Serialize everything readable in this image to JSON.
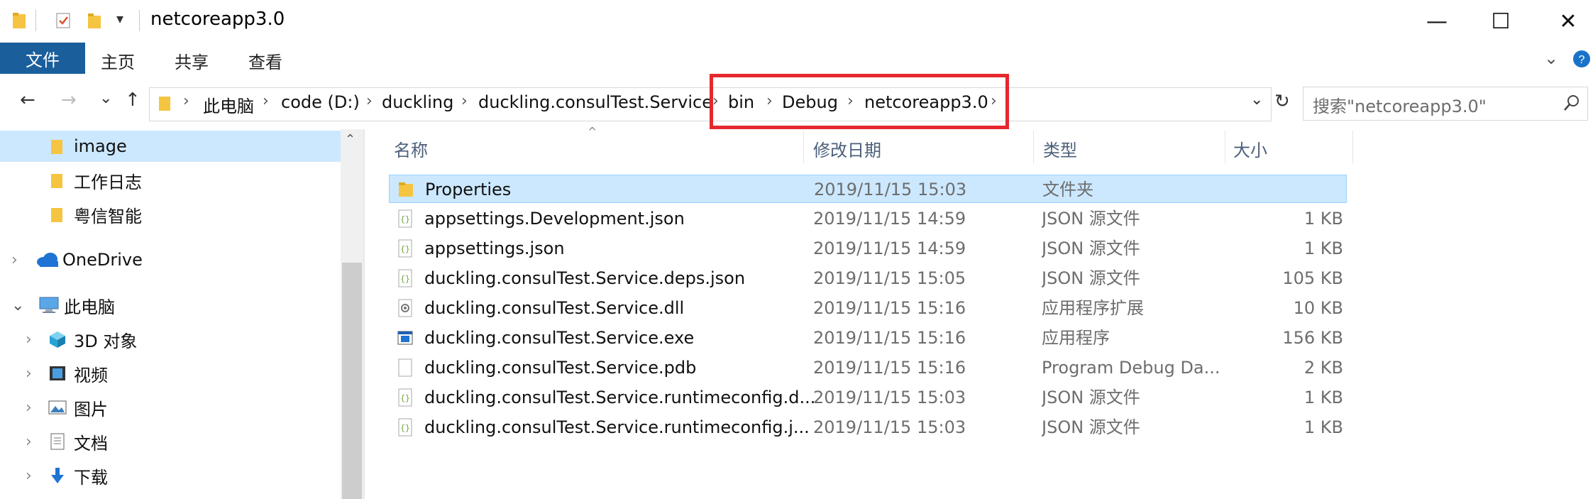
{
  "window": {
    "title": "netcoreapp3.0",
    "minimize_glyph": "—",
    "maximize_glyph": "☐",
    "close_glyph": "✕"
  },
  "ribbon": {
    "tabs": [
      "文件",
      "主页",
      "共享",
      "查看"
    ]
  },
  "nav": {
    "back_glyph": "←",
    "forward_glyph": "→",
    "recent_glyph": "⌄",
    "up_glyph": "↑",
    "refresh_glyph": "↻",
    "dropdown_glyph": "⌄"
  },
  "breadcrumb": [
    "此电脑",
    "code (D:)",
    "duckling",
    "duckling.consulTest.Service",
    "bin",
    "Debug",
    "netcoreapp3.0"
  ],
  "search": {
    "placeholder": "搜索\"netcoreapp3.0\""
  },
  "sidebar": {
    "items": [
      {
        "label": "image",
        "icon": "folder-icon",
        "selected": true
      },
      {
        "label": "工作日志",
        "icon": "folder-icon"
      },
      {
        "label": "粤信智能",
        "icon": "folder-icon"
      },
      {
        "label": "OneDrive",
        "icon": "cloud-icon",
        "expander": "›"
      },
      {
        "label": "此电脑",
        "icon": "computer-icon",
        "expander": "⌄"
      },
      {
        "label": "3D 对象",
        "icon": "cube-icon",
        "expander": "›"
      },
      {
        "label": "视频",
        "icon": "video-icon",
        "expander": "›"
      },
      {
        "label": "图片",
        "icon": "picture-icon",
        "expander": "›"
      },
      {
        "label": "文档",
        "icon": "document-icon",
        "expander": "›"
      },
      {
        "label": "下载",
        "icon": "download-icon",
        "expander": "›"
      }
    ]
  },
  "columns": {
    "name": "名称",
    "date": "修改日期",
    "type": "类型",
    "size": "大小"
  },
  "files": [
    {
      "name": "Properties",
      "date": "2019/11/15 15:03",
      "type": "文件夹",
      "size": "",
      "icon": "folder-icon",
      "selected": true
    },
    {
      "name": "appsettings.Development.json",
      "date": "2019/11/15 14:59",
      "type": "JSON 源文件",
      "size": "1 KB",
      "icon": "json-file-icon"
    },
    {
      "name": "appsettings.json",
      "date": "2019/11/15 14:59",
      "type": "JSON 源文件",
      "size": "1 KB",
      "icon": "json-file-icon"
    },
    {
      "name": "duckling.consulTest.Service.deps.json",
      "date": "2019/11/15 15:05",
      "type": "JSON 源文件",
      "size": "105 KB",
      "icon": "json-file-icon"
    },
    {
      "name": "duckling.consulTest.Service.dll",
      "date": "2019/11/15 15:16",
      "type": "应用程序扩展",
      "size": "10 KB",
      "icon": "dll-file-icon"
    },
    {
      "name": "duckling.consulTest.Service.exe",
      "date": "2019/11/15 15:16",
      "type": "应用程序",
      "size": "156 KB",
      "icon": "exe-file-icon"
    },
    {
      "name": "duckling.consulTest.Service.pdb",
      "date": "2019/11/15 15:16",
      "type": "Program Debug Da...",
      "size": "2 KB",
      "icon": "blank-file-icon"
    },
    {
      "name": "duckling.consulTest.Service.runtimeconfig.d...",
      "date": "2019/11/15 15:03",
      "type": "JSON 源文件",
      "size": "1 KB",
      "icon": "json-file-icon"
    },
    {
      "name": "duckling.consulTest.Service.runtimeconfig.j...",
      "date": "2019/11/15 15:03",
      "type": "JSON 源文件",
      "size": "1 KB",
      "icon": "json-file-icon"
    }
  ],
  "colors": {
    "accent": "#1a5f9c",
    "selection": "#cce8ff",
    "highlight_border": "#e5282d",
    "folder": "#f5c542"
  }
}
